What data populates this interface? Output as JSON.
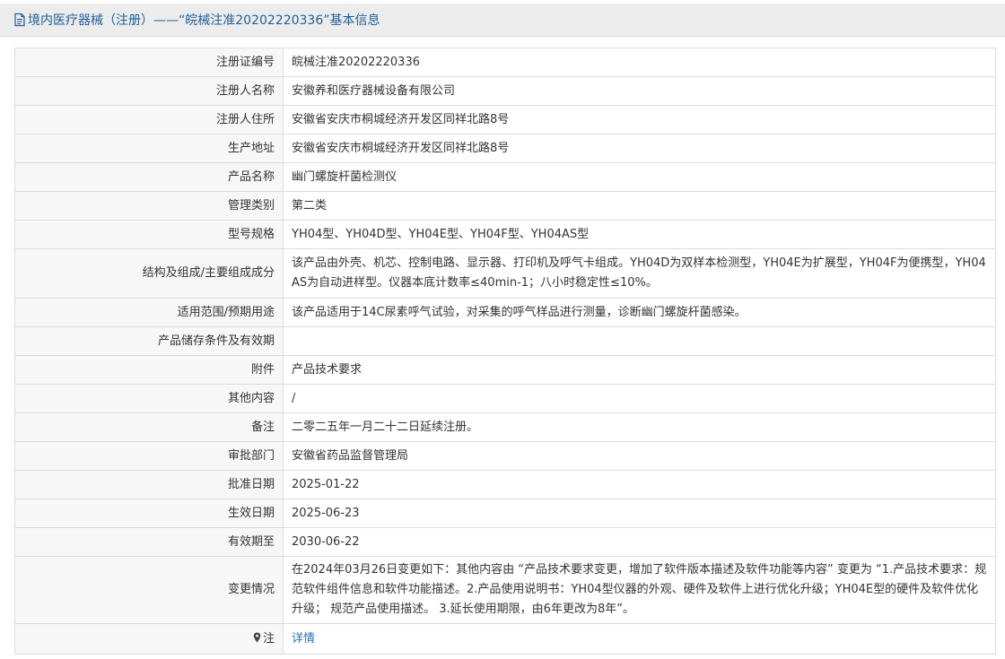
{
  "header": {
    "title": "境内医疗器械（注册）——“皖械注准20202220336”基本信息",
    "icon": "document-icon"
  },
  "fields": [
    {
      "label": "注册证编号",
      "value": "皖械注准20202220336"
    },
    {
      "label": "注册人名称",
      "value": "安徽养和医疗器械设备有限公司"
    },
    {
      "label": "注册人住所",
      "value": "安徽省安庆市桐城经济开发区同祥北路8号"
    },
    {
      "label": "生产地址",
      "value": "安徽省安庆市桐城经济开发区同祥北路8号"
    },
    {
      "label": "产品名称",
      "value": "幽门螺旋杆菌检测仪"
    },
    {
      "label": "管理类别",
      "value": "第二类"
    },
    {
      "label": "型号规格",
      "value": "YH04型、YH04D型、YH04E型、YH04F型、YH04AS型"
    },
    {
      "label": "结构及组成/主要组成成分",
      "value": "该产品由外壳、机芯、控制电路、显示器、打印机及呼气卡组成。YH04D为双样本检测型，YH04E为扩展型，YH04F为便携型，YH04AS为自动进样型。仪器本底计数率≤40min-1；八小时稳定性≤10%。"
    },
    {
      "label": "适用范围/预期用途",
      "value": "该产品适用于14C尿素呼气试验，对采集的呼气样品进行测量，诊断幽门螺旋杆菌感染。"
    },
    {
      "label": "产品储存条件及有效期",
      "value": ""
    },
    {
      "label": "附件",
      "value": "产品技术要求"
    },
    {
      "label": "其他内容",
      "value": "/"
    },
    {
      "label": "备注",
      "value": "二零二五年一月二十二日延续注册。"
    },
    {
      "label": "审批部门",
      "value": "安徽省药品监督管理局"
    },
    {
      "label": "批准日期",
      "value": "2025-01-22"
    },
    {
      "label": "生效日期",
      "value": "2025-06-23"
    },
    {
      "label": "有效期至",
      "value": "2030-06-22"
    },
    {
      "label": "变更情况",
      "value": "在2024年03月26日变更如下：其他内容由 “产品技术要求变更，增加了软件版本描述及软件功能等内容” 变更为 “1.产品技术要求：规范软件组件信息和软件功能描述。2.产品使用说明书：YH04型仪器的外观、硬件及软件上进行优化升级；YH04E型的硬件及软件优化升级； 规范产品使用描述。 3.延长使用期限，由6年更改为8年”。"
    }
  ],
  "note": {
    "label": "注",
    "icon": "pin-icon",
    "link_text": "详情"
  },
  "colors": {
    "header_bg": "#ececec",
    "title_color": "#1f5f99",
    "label_bg": "#f7f7f7",
    "border": "#dcdcdc",
    "link": "#1f6fbf"
  }
}
